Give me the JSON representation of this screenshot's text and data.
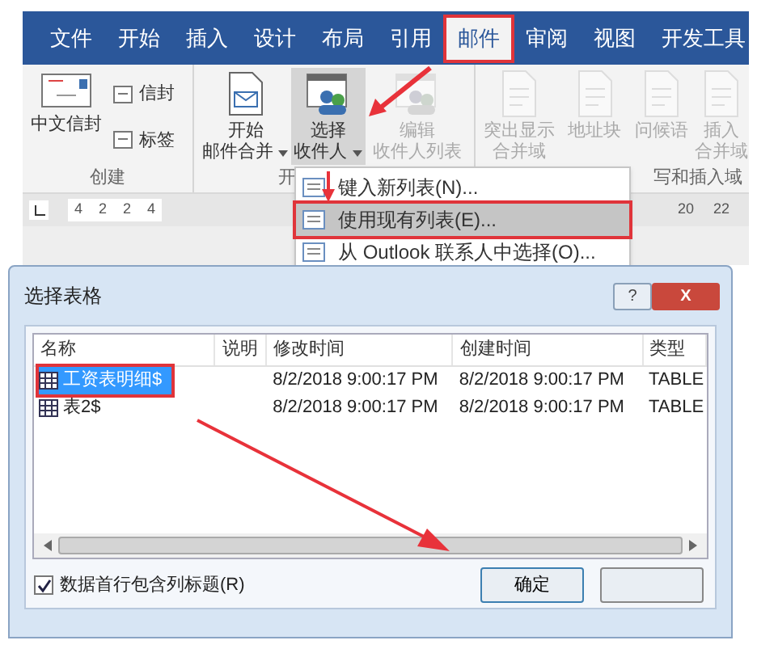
{
  "tabs": [
    {
      "label": "文件",
      "selected": false,
      "marked": false
    },
    {
      "label": "开始",
      "selected": false,
      "marked": false
    },
    {
      "label": "插入",
      "selected": false,
      "marked": false
    },
    {
      "label": "设计",
      "selected": false,
      "marked": false
    },
    {
      "label": "布局",
      "selected": false,
      "marked": false
    },
    {
      "label": "引用",
      "selected": false,
      "marked": false
    },
    {
      "label": "邮件",
      "selected": true,
      "marked": true
    },
    {
      "label": "审阅",
      "selected": false,
      "marked": false
    },
    {
      "label": "视图",
      "selected": false,
      "marked": false
    },
    {
      "label": "开发工具",
      "selected": false,
      "marked": false
    }
  ],
  "ribbon_groups": [
    {
      "label": "创建",
      "buttons": [
        {
          "kind": "large",
          "lines": [
            "中文信封"
          ]
        },
        {
          "kind": "small",
          "lines": [
            "信封"
          ]
        },
        {
          "kind": "small",
          "lines": [
            "标签"
          ]
        }
      ]
    },
    {
      "label": "开",
      "buttons": [
        {
          "kind": "large",
          "lines": [
            "开始",
            "邮件合并"
          ],
          "dropdown": true,
          "disabled": false,
          "pressed": false
        },
        {
          "kind": "large",
          "lines": [
            "选择",
            "收件人"
          ],
          "dropdown": true,
          "disabled": false,
          "pressed": true
        },
        {
          "kind": "large",
          "lines": [
            "编辑",
            "收件人列表"
          ],
          "dropdown": false,
          "disabled": true,
          "pressed": false
        }
      ]
    },
    {
      "label": "写和插入域",
      "buttons": [
        {
          "kind": "large",
          "lines": [
            "突出显示",
            "合并域"
          ],
          "dropdown": false,
          "disabled": true,
          "pressed": false
        },
        {
          "kind": "large",
          "lines": [
            "地址块"
          ],
          "dropdown": false,
          "disabled": true,
          "pressed": false
        },
        {
          "kind": "large",
          "lines": [
            "问候语"
          ],
          "dropdown": false,
          "disabled": true,
          "pressed": false
        },
        {
          "kind": "large",
          "lines": [
            "插入",
            "合并域"
          ],
          "dropdown": false,
          "disabled": true,
          "pressed": false
        }
      ]
    }
  ],
  "ruler": {
    "left_labels": [
      "4",
      "2",
      "2",
      "4"
    ],
    "right_labels": [
      "20",
      "22"
    ]
  },
  "dropdown_menu": {
    "items": [
      {
        "label": "键入新列表(N)...",
        "highlighted": false,
        "marked": false
      },
      {
        "label": "使用现有列表(E)...",
        "highlighted": true,
        "marked": true
      },
      {
        "label": "从 Outlook 联系人中选择(O)...",
        "highlighted": false,
        "marked": false
      }
    ]
  },
  "dialog": {
    "title": "选择表格",
    "help": "?",
    "close": "X",
    "columns": [
      "名称",
      "说明",
      "修改时间",
      "创建时间",
      "类型"
    ],
    "rows": [
      {
        "selected": true,
        "marked": true,
        "cells": [
          "工资表明细$",
          "",
          "8/2/2018 9:00:17 PM",
          "8/2/2018 9:00:17 PM",
          "TABLE"
        ]
      },
      {
        "selected": false,
        "marked": false,
        "cells": [
          "表2$",
          "",
          "8/2/2018 9:00:17 PM",
          "8/2/2018 9:00:17 PM",
          "TABLE"
        ]
      }
    ],
    "checkbox": {
      "label": "数据首行包含列标题(R)",
      "checked": true
    },
    "buttons": [
      {
        "kind": "labeled",
        "label": "确定"
      },
      {
        "kind": "unlabeled"
      }
    ]
  }
}
